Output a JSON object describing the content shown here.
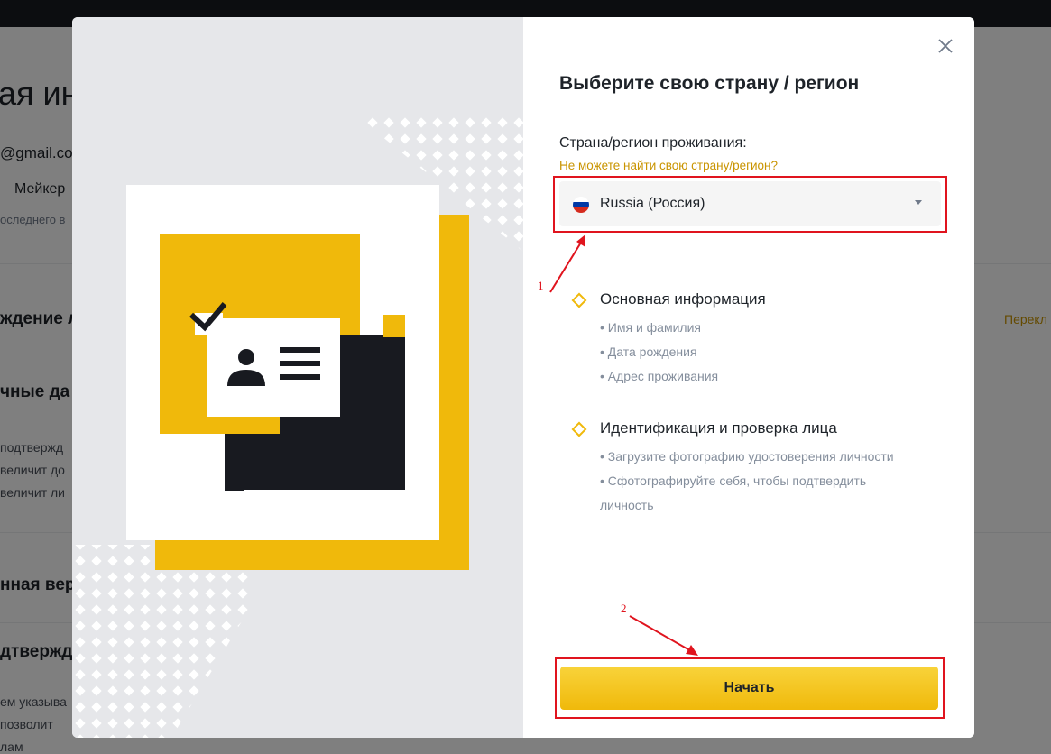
{
  "background": {
    "title_fragment": "ая ин",
    "email_fragment": "@gmail.co",
    "fee_fragment": "Мейкер",
    "login_fragment": "оследнего в",
    "row1": "ждение л",
    "row1_right": "Перекл",
    "row2": "чные да",
    "row3a": "подтвержд",
    "row3b": "величит до",
    "row3c": "величит ли",
    "row4": "нная вер",
    "row5": "дтвержд",
    "row6a": "ем указыва",
    "row6b": "позволит",
    "row6c": "лам"
  },
  "modal": {
    "title": "Выберите свою страну / регион",
    "country_label": "Страна/регион проживания:",
    "cant_find_link": "Не можете найти свою страну/регион?",
    "selected_country": "Russia (Россия)",
    "section1": {
      "title": "Основная информация",
      "items": [
        "• Имя и фамилия",
        "• Дата рождения",
        "• Адрес проживания"
      ]
    },
    "section2": {
      "title": "Идентификация и проверка лица",
      "items": [
        "• Загрузите фотографию удостоверения личности",
        "• Сфотографируйте себя, чтобы подтвердить",
        "личность"
      ]
    },
    "start_button": "Начать"
  },
  "annotations": {
    "marker1": "1",
    "marker2": "2"
  },
  "colors": {
    "accent": "#f0b90b",
    "link": "#c99400",
    "annotation": "#e0141e",
    "dark": "#1e2329"
  },
  "icons": {
    "close": "close-icon",
    "flag": "russia-flag-icon",
    "caret": "caret-down-icon",
    "bullet": "diamond-icon"
  }
}
